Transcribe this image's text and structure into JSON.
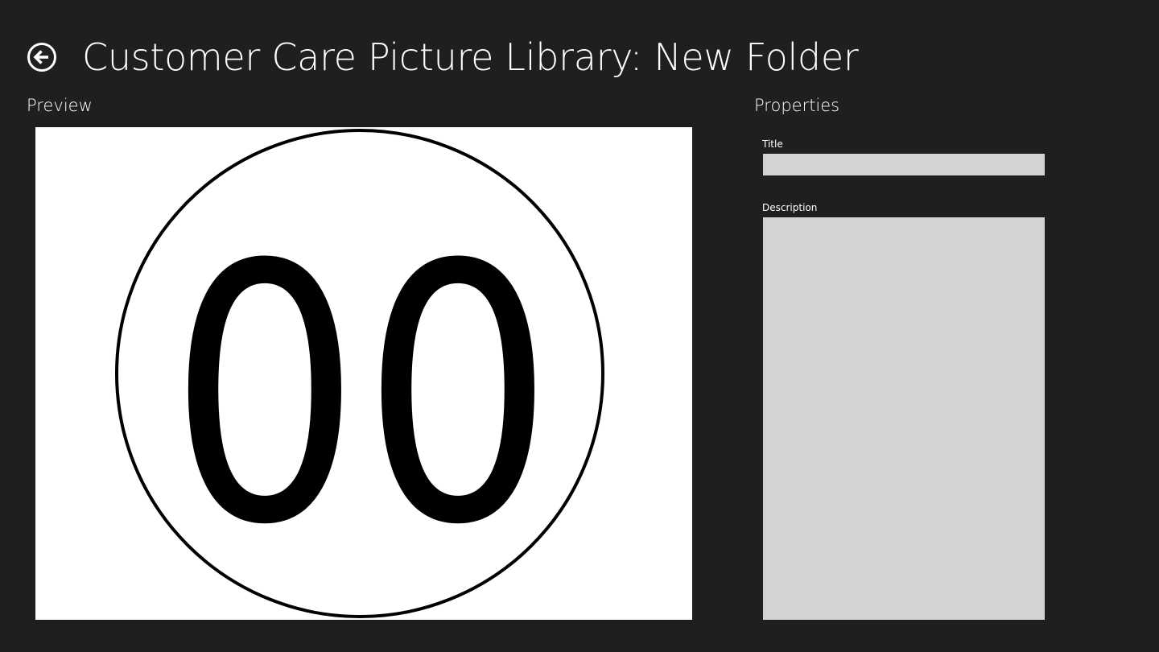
{
  "header": {
    "title": "Customer Care Picture Library: New Folder",
    "back_icon": "back-arrow-circle-icon"
  },
  "preview": {
    "label": "Preview",
    "image_text": "00"
  },
  "properties": {
    "label": "Properties",
    "title_field": {
      "label": "Title",
      "value": ""
    },
    "description_field": {
      "label": "Description",
      "value": ""
    }
  },
  "colors": {
    "background": "#1f1f1f",
    "input_fill": "#d3d3d3",
    "text": "#ffffff",
    "preview_background": "#ffffff"
  }
}
